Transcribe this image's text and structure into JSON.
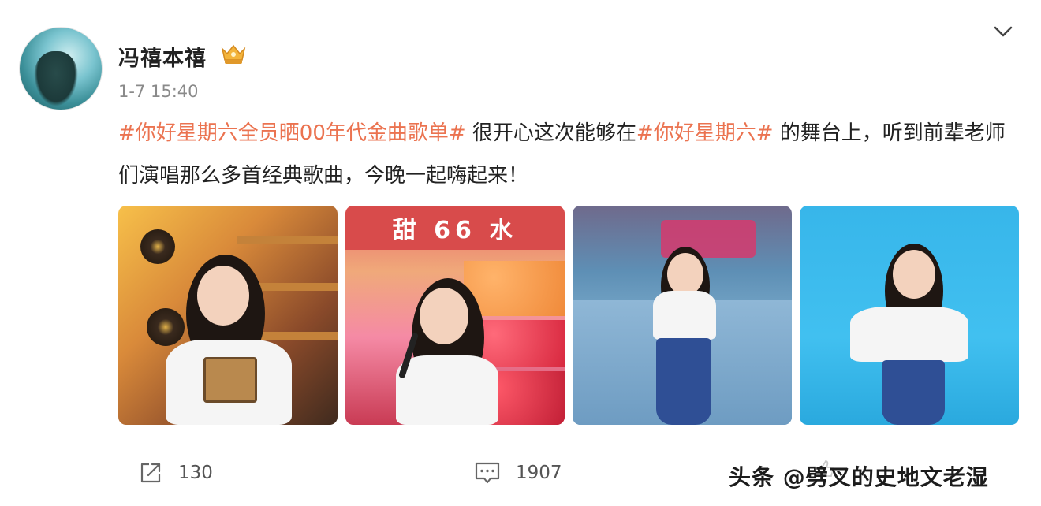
{
  "post": {
    "username": "冯禧本禧",
    "timestamp": "1-7 15:40",
    "text_parts": {
      "tag1": "#你好星期六全员晒00年代金曲歌单#",
      "text1": " 很开心这次能够在",
      "tag2": "#你好星期六#",
      "text2": " 的舞台上，听到前辈老师们演唱那么多首经典歌曲，今晚一起嗨起来！"
    },
    "photo2_sign": "甜 66 水"
  },
  "actions": {
    "share_count": "130",
    "comment_count": "1907"
  },
  "watermark": "头条 @劈叉的史地文老湿",
  "colors": {
    "hashtag": "#eb7350",
    "text": "#222222",
    "muted": "#8a8a8a"
  }
}
